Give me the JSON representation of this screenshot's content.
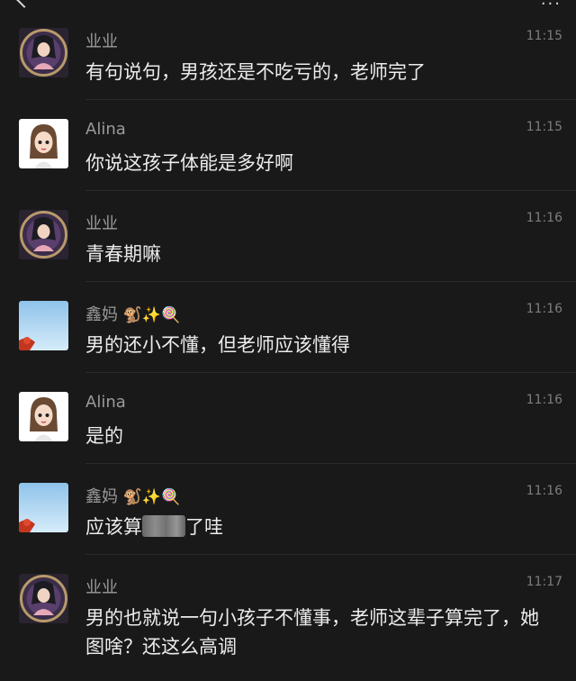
{
  "header": {
    "back_icon": "chevron-left-icon",
    "more_icon": "more-dots-icon"
  },
  "messages": [
    {
      "sender": "业业",
      "time": "11:15",
      "avatar": "anime-girl-avatar",
      "text": "有句说句，男孩还是不吃亏的，老师完了"
    },
    {
      "sender": "Alina",
      "time": "11:15",
      "avatar": "cartoon-girl-avatar",
      "text": "你说这孩子体能是多好啊"
    },
    {
      "sender": "业业",
      "time": "11:16",
      "avatar": "anime-girl-avatar",
      "text": "青春期嘛"
    },
    {
      "sender": "鑫妈",
      "sender_emoji": "🐒✨🍭",
      "time": "11:16",
      "avatar": "sky-avatar",
      "text": "男的还小不懂，但老师应该懂得"
    },
    {
      "sender": "Alina",
      "time": "11:16",
      "avatar": "cartoon-girl-avatar",
      "text": "是的"
    },
    {
      "sender": "鑫妈",
      "sender_emoji": "🐒✨🍭",
      "time": "11:16",
      "avatar": "sky-avatar",
      "text_before": "应该算",
      "text_after": "了哇"
    },
    {
      "sender": "业业",
      "time": "11:17",
      "avatar": "anime-girl-avatar",
      "text": "男的也就说一句小孩子不懂事，老师这辈子算完了，她图啥？还这么高调"
    }
  ]
}
